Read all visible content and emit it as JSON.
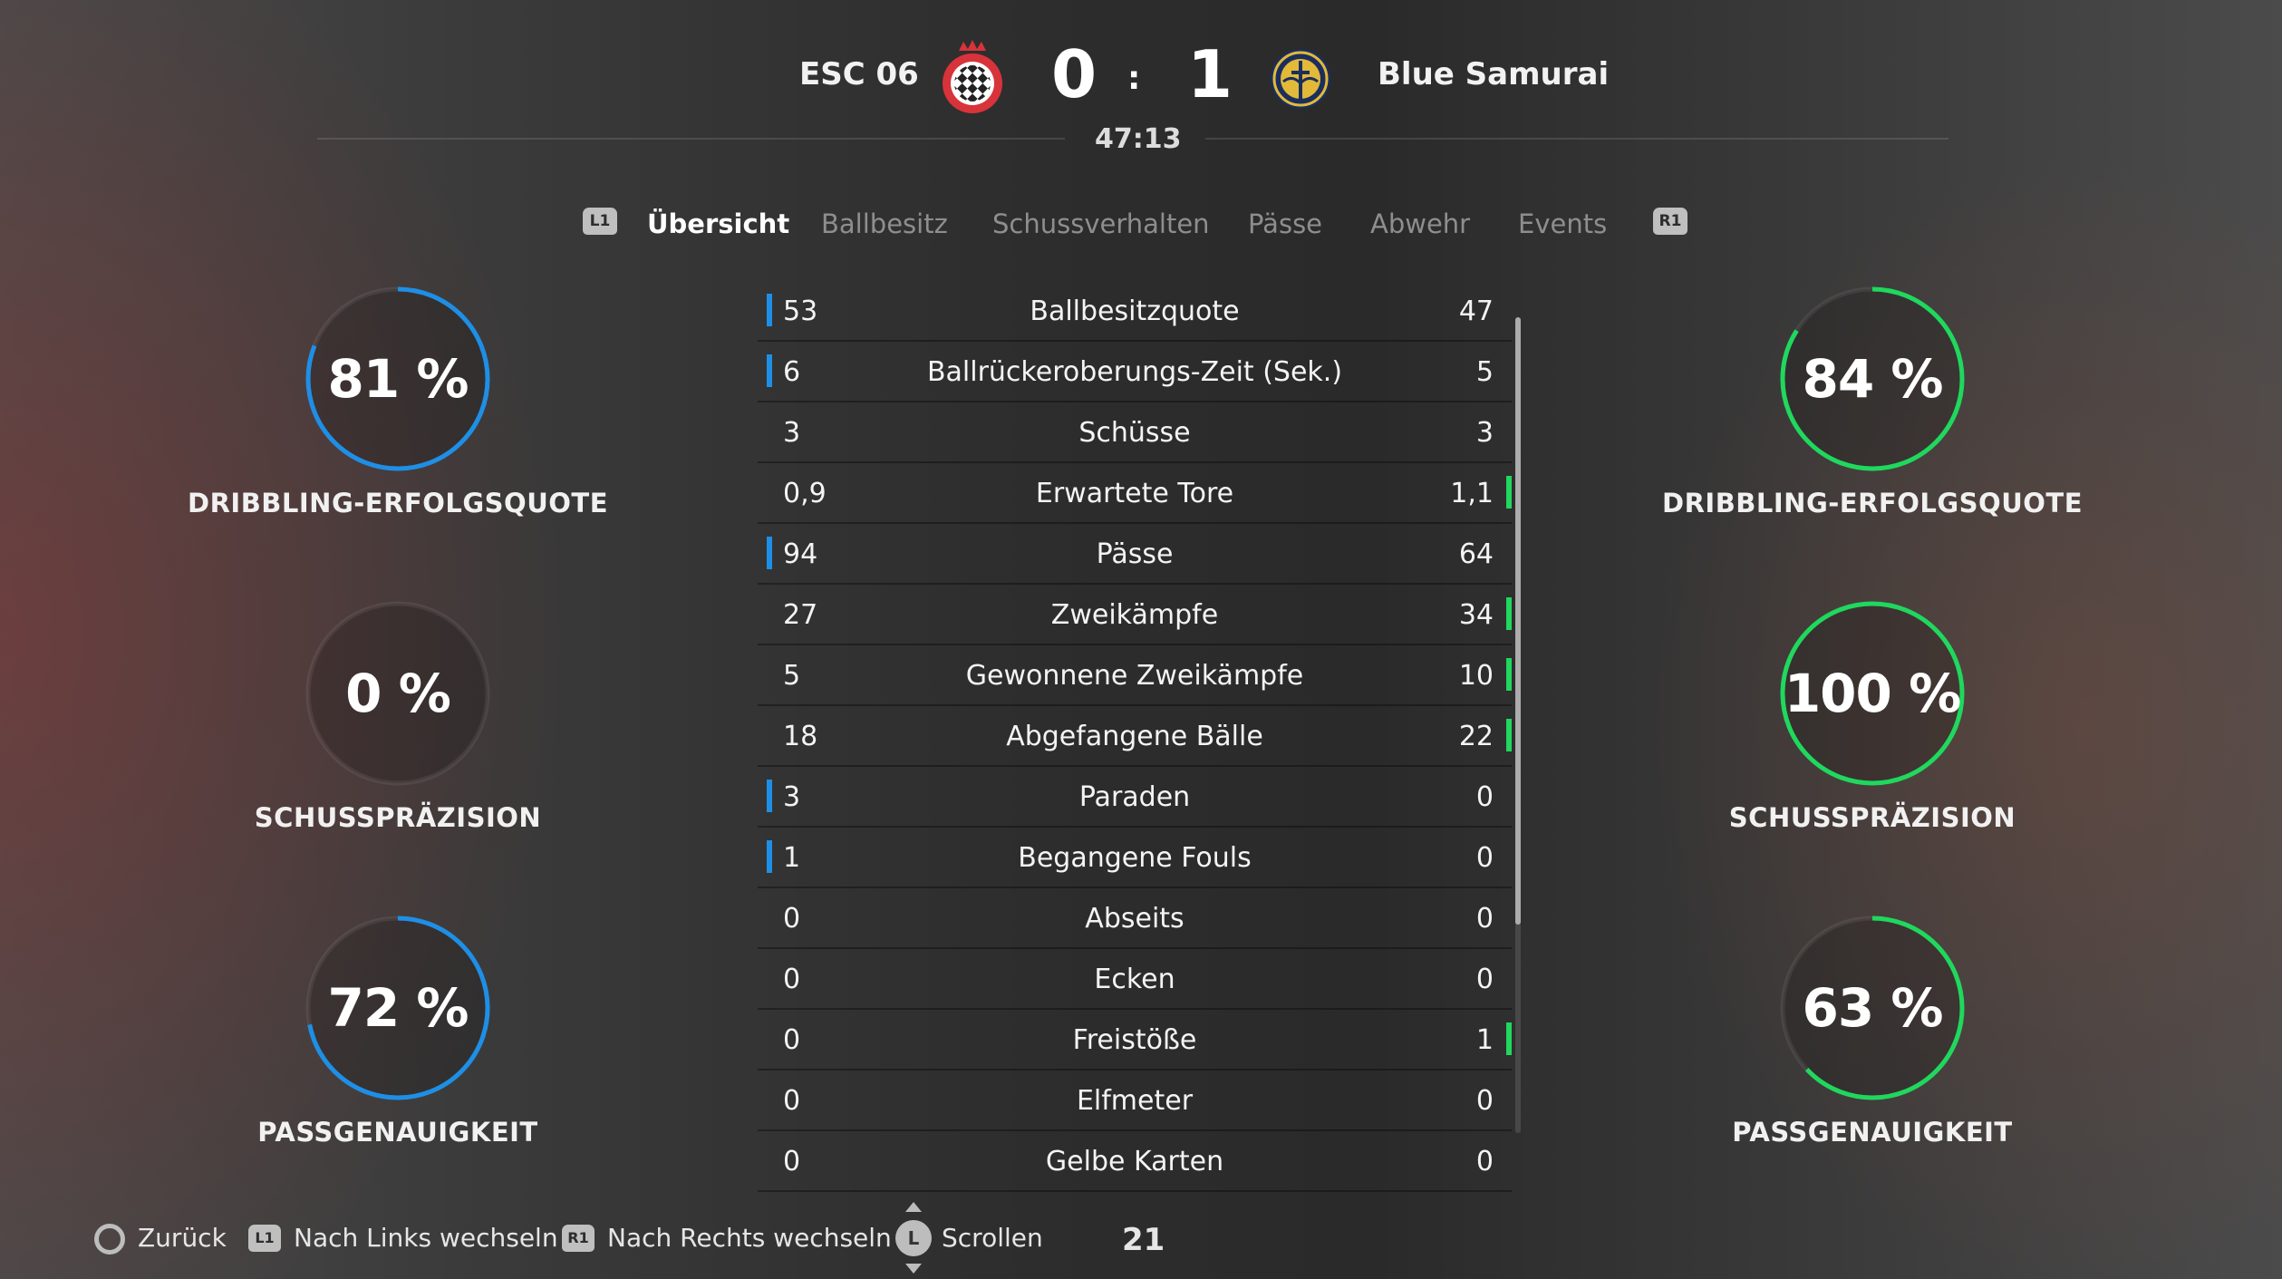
{
  "header": {
    "home_team": "ESC 06",
    "away_team": "Blue Samurai",
    "home_score": "0",
    "away_score": "1",
    "separator": ":",
    "match_time": "47:13",
    "home_color": "#d8333a",
    "away_color": "#1b2f5c"
  },
  "tabs": {
    "left_button": "L1",
    "right_button": "R1",
    "items": [
      {
        "label": "Übersicht"
      },
      {
        "label": "Ballbesitz"
      },
      {
        "label": "Schussverhalten"
      },
      {
        "label": "Pässe"
      },
      {
        "label": "Abwehr"
      },
      {
        "label": "Events"
      }
    ]
  },
  "home_rings": [
    {
      "value_text": "81 %",
      "fraction": 0.81,
      "label": "DRIBBLING-ERFOLGSQUOTE"
    },
    {
      "value_text": "0 %",
      "fraction": 0.0,
      "label": "SCHUSSPRÄZISION"
    },
    {
      "value_text": "72 %",
      "fraction": 0.72,
      "label": "PASSGENAUIGKEIT"
    }
  ],
  "away_rings": [
    {
      "value_text": "84 %",
      "fraction": 0.84,
      "label": "DRIBBLING-ERFOLGSQUOTE"
    },
    {
      "value_text": "100 %",
      "fraction": 1.0,
      "label": "SCHUSSPRÄZISION"
    },
    {
      "value_text": "63 %",
      "fraction": 0.63,
      "label": "PASSGENAUIGKEIT"
    }
  ],
  "colors": {
    "home_accent": "#1e8fe6",
    "away_accent": "#1fd85d"
  },
  "stats": [
    {
      "name": "Ballbesitzquote",
      "home": "53",
      "away": "47",
      "lead": "home"
    },
    {
      "name": "Ballrückeroberungs-Zeit (Sek.)",
      "home": "6",
      "away": "5",
      "lead": "home"
    },
    {
      "name": "Schüsse",
      "home": "3",
      "away": "3",
      "lead": "none"
    },
    {
      "name": "Erwartete Tore",
      "home": "0,9",
      "away": "1,1",
      "lead": "away"
    },
    {
      "name": "Pässe",
      "home": "94",
      "away": "64",
      "lead": "home"
    },
    {
      "name": "Zweikämpfe",
      "home": "27",
      "away": "34",
      "lead": "away"
    },
    {
      "name": "Gewonnene Zweikämpfe",
      "home": "5",
      "away": "10",
      "lead": "away"
    },
    {
      "name": "Abgefangene Bälle",
      "home": "18",
      "away": "22",
      "lead": "away"
    },
    {
      "name": "Paraden",
      "home": "3",
      "away": "0",
      "lead": "home"
    },
    {
      "name": "Begangene Fouls",
      "home": "1",
      "away": "0",
      "lead": "home"
    },
    {
      "name": "Abseits",
      "home": "0",
      "away": "0",
      "lead": "none"
    },
    {
      "name": "Ecken",
      "home": "0",
      "away": "0",
      "lead": "none"
    },
    {
      "name": "Freistöße",
      "home": "0",
      "away": "1",
      "lead": "away"
    },
    {
      "name": "Elfmeter",
      "home": "0",
      "away": "0",
      "lead": "none"
    },
    {
      "name": "Gelbe Karten",
      "home": "0",
      "away": "0",
      "lead": "none"
    }
  ],
  "footer": {
    "back_label": "Zurück",
    "left_badge": "L1",
    "left_label": "Nach Links wechseln",
    "right_badge": "R1",
    "right_label": "Nach Rechts wechseln",
    "stick_badge": "L",
    "scroll_label": "Scrollen",
    "page_number": "21"
  }
}
